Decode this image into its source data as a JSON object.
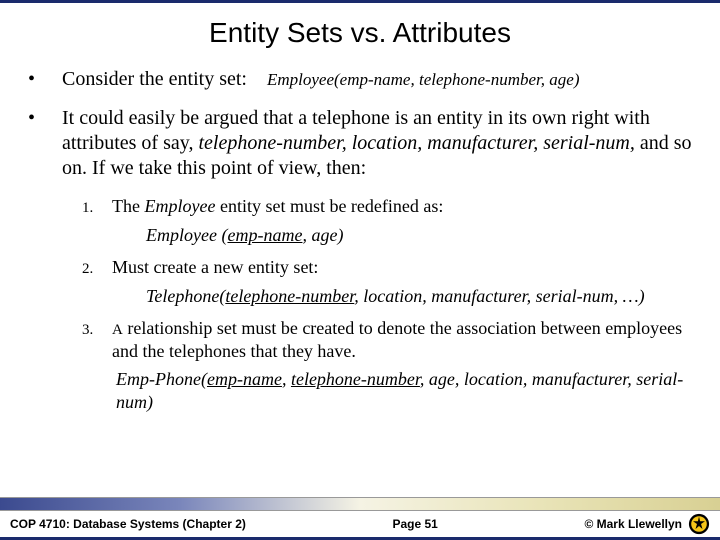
{
  "title": "Entity Sets vs. Attributes",
  "bullets": {
    "b1_lead": "Consider the entity set:",
    "b1_def": "Employee(emp-name, telephone-number, age)",
    "b2_p1": "It could easily be argued that a telephone is an entity in its own right with attributes of say, ",
    "b2_it": "telephone-number, location, manufacturer, serial-num,",
    "b2_p2": " and so on.  If we take this point of view, then:"
  },
  "list": {
    "n1_text_a": "The ",
    "n1_text_it": "Employee",
    "n1_text_b": " entity set must be redefined as:",
    "n1_sub_a": "Employee (",
    "n1_sub_u": "emp-name",
    "n1_sub_b": ", age)",
    "n2_text": "Must create a new entity set:",
    "n2_sub_a": "Telephone(",
    "n2_sub_u": "telephone-number",
    "n2_sub_b": ", location, manufacturer, serial-num, …)",
    "n3_text_a": "A",
    "n3_text_b": " relationship set must be created to denote the association between employees and the telephones that they have.",
    "n3_sub_a": "Emp-Phone(",
    "n3_sub_u1": "emp-name",
    "n3_sub_c": ", ",
    "n3_sub_u2": "telephone-number",
    "n3_sub_b": ", age, location, manufacturer, serial-num)"
  },
  "footer": {
    "course": "COP 4710: Database Systems  (Chapter 2)",
    "page": "Page 51",
    "copyright": "© Mark Llewellyn"
  }
}
